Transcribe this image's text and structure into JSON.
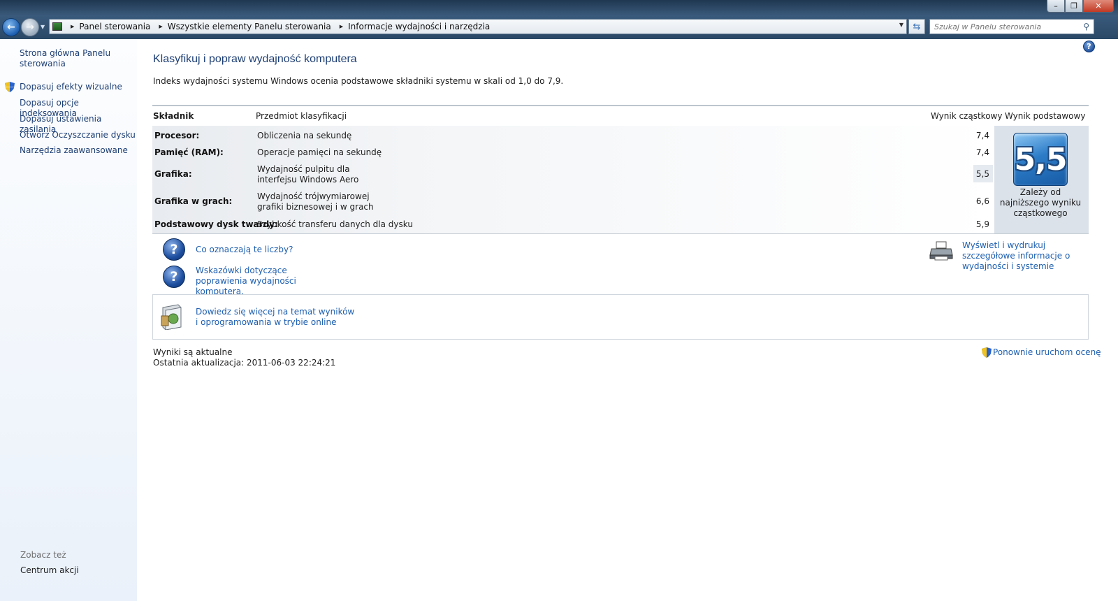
{
  "window": {
    "min": "–",
    "max": "❐",
    "close": "✕"
  },
  "address": {
    "crumbs": [
      "Panel sterowania",
      "Wszystkie elementy Panelu sterowania",
      "Informacje wydajności i narzędzia"
    ],
    "search_placeholder": "Szukaj w Panelu sterowania"
  },
  "sidebar": {
    "home": "Strona główna Panelu sterowania",
    "items": [
      "Dopasuj efekty wizualne",
      "Dopasuj opcje indeksowania",
      "Dopasuj ustawienia zasilania",
      "Otwórz Oczyszczanie dysku",
      "Narzędzia zaawansowane"
    ],
    "see_also": "Zobacz też",
    "action_center": "Centrum akcji"
  },
  "main": {
    "title": "Klasyfikuj i popraw wydajność komputera",
    "description": "Indeks wydajności systemu Windows ocenia podstawowe składniki systemu w skali od 1,0 do 7,9.",
    "columns": {
      "component": "Składnik",
      "item": "Przedmiot klasyfikacji",
      "subscore": "Wynik cząstkowy",
      "base": "Wynik podstawowy"
    },
    "rows": [
      {
        "component": "Procesor:",
        "item": "Obliczenia na sekundę",
        "score": "7,4"
      },
      {
        "component": "Pamięć (RAM):",
        "item": "Operacje pamięci na sekundę",
        "score": "7,4"
      },
      {
        "component": "Grafika:",
        "item": "Wydajność pulpitu dla interfejsu Windows Aero",
        "score": "5,5"
      },
      {
        "component": "Grafika w grach:",
        "item": "Wydajność trójwymiarowej grafiki biznesowej i w grach",
        "score": "6,6"
      },
      {
        "component": "Podstawowy dysk twardy:",
        "item": "Szybkość transferu danych dla dysku",
        "score": "5,9"
      }
    ],
    "base_score": "5,5",
    "base_note": "Zależy od najniższego wyniku cząstkowego",
    "links": {
      "what_numbers": "Co oznaczają te liczby?",
      "tips": "Wskazówki dotyczące poprawienia wydajności komputera.",
      "print": "Wyświetl i wydrukuj szczegółowe informacje o wydajności i systemie",
      "online": "Dowiedz się więcej na temat wyników i oprogramowania w trybie online"
    },
    "status": "Wyniki są aktualne",
    "last_update": "Ostatnia aktualizacja: 2011-06-03 22:24:21",
    "rerun": "Ponownie uruchom ocenę"
  }
}
